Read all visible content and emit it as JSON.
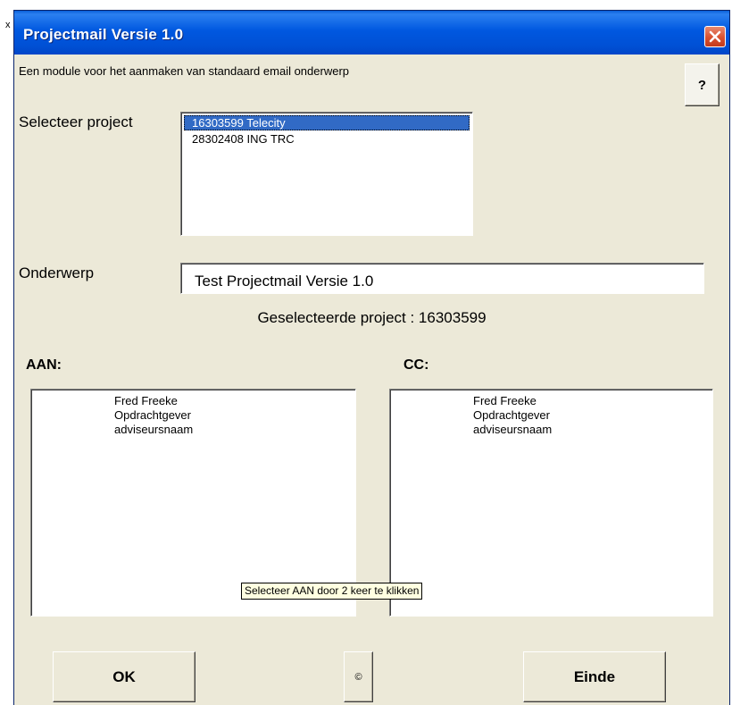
{
  "edge_glyph": "x",
  "window": {
    "title": "Projectmail Versie 1.0",
    "close_icon": "close-x-icon",
    "description": "Een module voor het aanmaken van standaard email onderwerp",
    "help_label": "?"
  },
  "project": {
    "label": "Selecteer project",
    "items": [
      {
        "text": "16303599 Telecity",
        "selected": true
      },
      {
        "text": "28302408 ING TRC",
        "selected": false
      }
    ]
  },
  "subject": {
    "label": "Onderwerp",
    "value": "Test Projectmail Versie 1.0"
  },
  "selected_project_text": "Geselecteerde project : 16303599",
  "aan": {
    "label": "AAN:",
    "items": [
      "Fred Freeke",
      "Opdrachtgever",
      "adviseursnaam"
    ]
  },
  "cc": {
    "label": "CC:",
    "items": [
      "Fred Freeke",
      "Opdrachtgever",
      "adviseursnaam"
    ]
  },
  "tooltip": "Selecteer AAN door 2 keer te klikken",
  "buttons": {
    "ok": "OK",
    "copyright": "©",
    "end": "Einde"
  },
  "colors": {
    "titlebar": "#0058e0",
    "selection": "#316ac5",
    "close": "#d8502f",
    "dialog_bg": "#ece9d8",
    "tooltip_bg": "#ffffe1"
  }
}
